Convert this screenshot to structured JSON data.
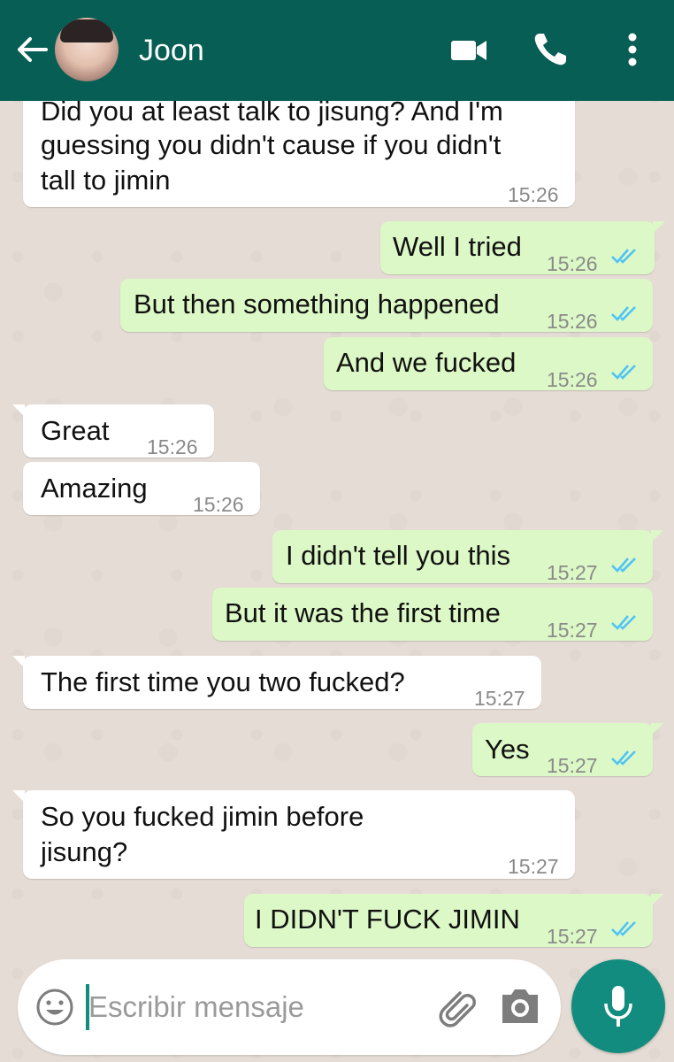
{
  "header": {
    "contact_name": "Joon"
  },
  "messages": [
    {
      "direction": "in",
      "lines": [
        "Did you at least talk to jisung? And I'm",
        "guessing you didn't cause if you didn't",
        "tall to jimin"
      ],
      "time": "15:26"
    },
    {
      "direction": "out",
      "text": "Well I tried",
      "time": "15:26",
      "status": "read"
    },
    {
      "direction": "out",
      "text": "But then something happened",
      "time": "15:26",
      "status": "read"
    },
    {
      "direction": "out",
      "text": "And we fucked",
      "time": "15:26",
      "status": "read"
    },
    {
      "direction": "in",
      "text": "Great",
      "time": "15:26"
    },
    {
      "direction": "in",
      "text": "Amazing",
      "time": "15:26"
    },
    {
      "direction": "out",
      "text": "I didn't tell you this",
      "time": "15:27",
      "status": "read"
    },
    {
      "direction": "out",
      "text": "But it was the first time",
      "time": "15:27",
      "status": "read"
    },
    {
      "direction": "in",
      "text": "The first time you two fucked?",
      "time": "15:27"
    },
    {
      "direction": "out",
      "text": "Yes",
      "time": "15:27",
      "status": "read"
    },
    {
      "direction": "in",
      "lines": [
        "So you fucked jimin before",
        "jisung?"
      ],
      "time": "15:27"
    },
    {
      "direction": "out",
      "text": "I DIDN'T FUCK JIMIN",
      "time": "15:27",
      "status": "read"
    }
  ],
  "composer": {
    "placeholder": "Escribir mensaje",
    "value": ""
  },
  "icons": {
    "back": "arrow-left-icon",
    "video": "video-call-icon",
    "phone": "phone-call-icon",
    "menu": "more-vertical-icon",
    "emoji": "emoji-icon",
    "attach": "paperclip-icon",
    "camera": "camera-icon",
    "mic": "microphone-icon",
    "read": "double-check-icon"
  },
  "colors": {
    "header": "#075e54",
    "outgoing_bubble": "#dcf8c6",
    "incoming_bubble": "#ffffff",
    "read_ticks": "#4fc3f7",
    "mic_button": "#128c7e"
  }
}
